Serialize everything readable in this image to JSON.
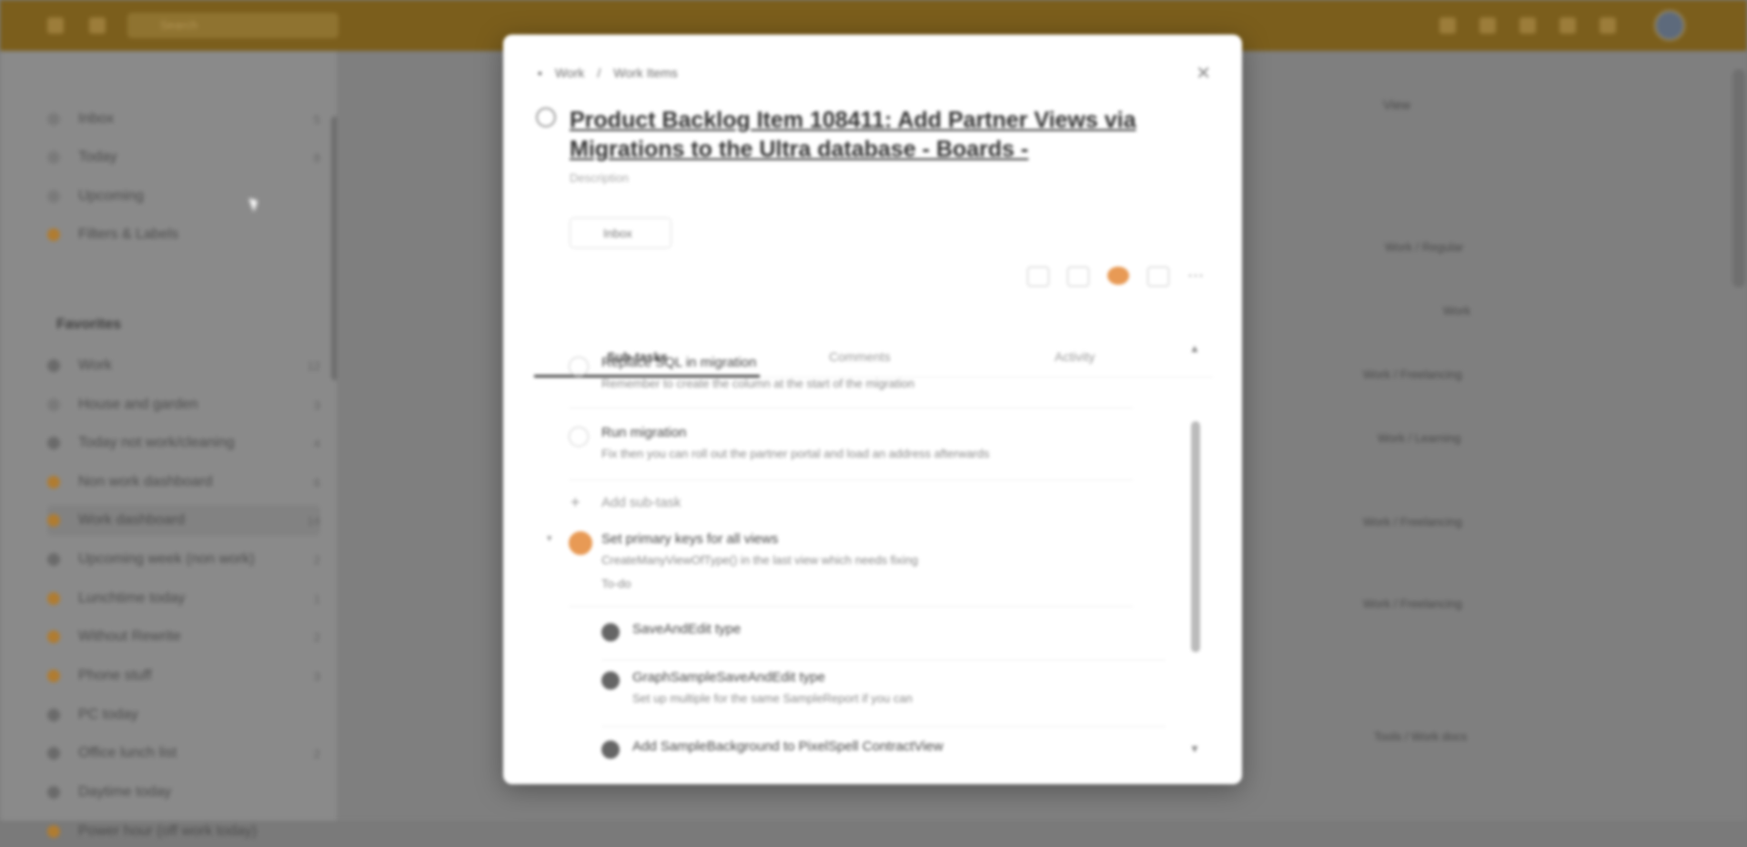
{
  "topbar": {
    "search_placeholder": "Search"
  },
  "sidebar": {
    "nav": [
      {
        "label": "Inbox",
        "count": "5",
        "color": "#7a7a7a"
      },
      {
        "label": "Today",
        "count": "8",
        "color": "#7a7a7a"
      },
      {
        "label": "Upcoming",
        "count": "",
        "color": "#7a7a7a"
      },
      {
        "label": "Filters & Labels",
        "count": "",
        "color": "#b07c30"
      }
    ],
    "section_title": "Favorites",
    "favorites": [
      {
        "label": "Work",
        "count": "12",
        "color": "#6a6a6a"
      },
      {
        "label": "House and garden",
        "count": "3",
        "color": "#7a7a7a"
      },
      {
        "label": "Today not work/cleaning",
        "count": "4",
        "color": "#6a6a6a"
      },
      {
        "label": "Non work dashboard",
        "count": "6",
        "color": "#b07c30"
      },
      {
        "label": "Work dashboard",
        "count": "14",
        "color": "#b07c30"
      },
      {
        "label": "Upcoming week (non work)",
        "count": "2",
        "color": "#6a6a6a"
      },
      {
        "label": "Lunchtime today",
        "count": "1",
        "color": "#b07c30"
      },
      {
        "label": "Without Rewrite",
        "count": "2",
        "color": "#b07c30"
      },
      {
        "label": "Phone stuff",
        "count": "3",
        "color": "#b07c30"
      },
      {
        "label": "PC today",
        "count": "",
        "color": "#6a6a6a"
      },
      {
        "label": "Office lunch list",
        "count": "2",
        "color": "#6a6a6a"
      },
      {
        "label": "Daytime today",
        "count": "",
        "color": "#6a6a6a"
      },
      {
        "label": "Power hour (off work today)",
        "count": "",
        "color": "#b07c30"
      }
    ]
  },
  "main": {
    "view_label": "View",
    "rows": [
      "Work / Regular",
      "Work",
      "Work / Freelancing",
      "Work / Learning",
      "Work / Freelancing",
      "Work / Freelancing",
      "Tools / Work docs"
    ]
  },
  "modal": {
    "breadcrumb": [
      "Work",
      "/",
      "Work Items"
    ],
    "close": "✕",
    "title": "Product Backlog Item 108411: Add Partner Views via Migrations to the Ultra database - Boards -",
    "description_placeholder": "Description",
    "inbox_label": "Inbox",
    "tabs": [
      "Sub-tasks",
      "Comments",
      "Activity"
    ],
    "subtasks": [
      {
        "title": "Replace SQL in migration",
        "desc": "Remember to create the column at the start of the migration",
        "state": "open"
      },
      {
        "title": "Run migration",
        "desc": "Fix then you can roll out the partner portal and load an address afterwards",
        "state": "open"
      },
      {
        "title": "Add sub-task",
        "desc": "",
        "state": "add"
      },
      {
        "title": "Set primary keys for all views",
        "desc": "CreateManyViewOfType() in the last view which needs fixing",
        "extra": "To-do",
        "state": "priority"
      },
      {
        "title": "SaveAndEdit type",
        "desc": "",
        "state": "child"
      },
      {
        "title": "GraphSampleSaveAndEdit type",
        "desc": "Set up multiple for the same SampleReport if you can",
        "state": "child"
      },
      {
        "title": "Add SampleBackground to PixelSpell ContractView",
        "desc": "",
        "state": "child"
      }
    ]
  }
}
